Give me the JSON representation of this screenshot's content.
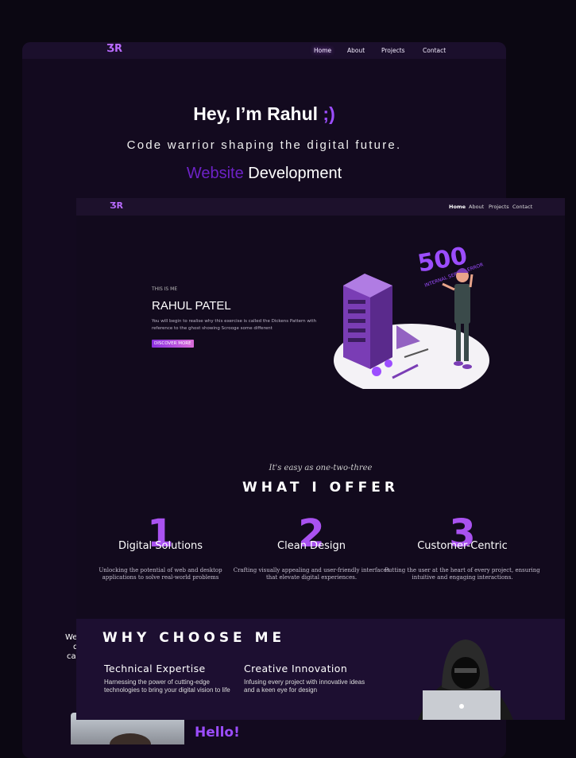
{
  "back": {
    "logo": "ƷR",
    "nav": [
      "Home",
      "About",
      "Projects",
      "Contact"
    ],
    "hero_title_main": "Hey, I’m Rahul",
    "hero_title_accent": ";)",
    "hero_sub": "Code warrior shaping the digital future.",
    "typed_1": "Website",
    "typed_2": "Development",
    "side_text": [
      "Wel",
      "d",
      "car"
    ],
    "hello": "Hello!"
  },
  "front": {
    "logo": "ƷR",
    "nav": [
      "Home",
      "About",
      "Projects",
      "Contact"
    ],
    "this_is": "THIS IS ME",
    "name": "RAHUL PATEL",
    "intro": "You will begin to realise why this exercise is called the Dickens Pattern with reference to the ghost showing Scrooge some different",
    "discover": "DISCOVER MORE",
    "illustration": {
      "big": "500",
      "small": "INTERNAL SERVER ERROR"
    },
    "tagline": "It's easy as one-two-three",
    "offer_title": "WHAT I OFFER",
    "offers": [
      {
        "num": "1",
        "title": "Digital Solutions",
        "desc": "Unlocking the potential of web and desktop applications to solve real-world problems"
      },
      {
        "num": "2",
        "title": "Clean Design",
        "desc": "Crafting visually appealing and user-friendly interfaces that elevate digital experiences."
      },
      {
        "num": "3",
        "title": "Customer-Centric",
        "desc": "Putting the user at the heart of every project, ensuring intuitive and engaging interactions."
      }
    ],
    "why_title": "WHY CHOOSE ME",
    "why": [
      {
        "title": "Technical Expertise",
        "desc": "Harnessing the power of cutting-edge technologies to bring your digital vision to life"
      },
      {
        "title": "Creative Innovation",
        "desc": "Infusing every project with innovative ideas and a keen eye for design"
      }
    ]
  },
  "colors": {
    "accent": "#9c4dff",
    "bg": "#120a1d",
    "panel": "#1d0f31"
  }
}
